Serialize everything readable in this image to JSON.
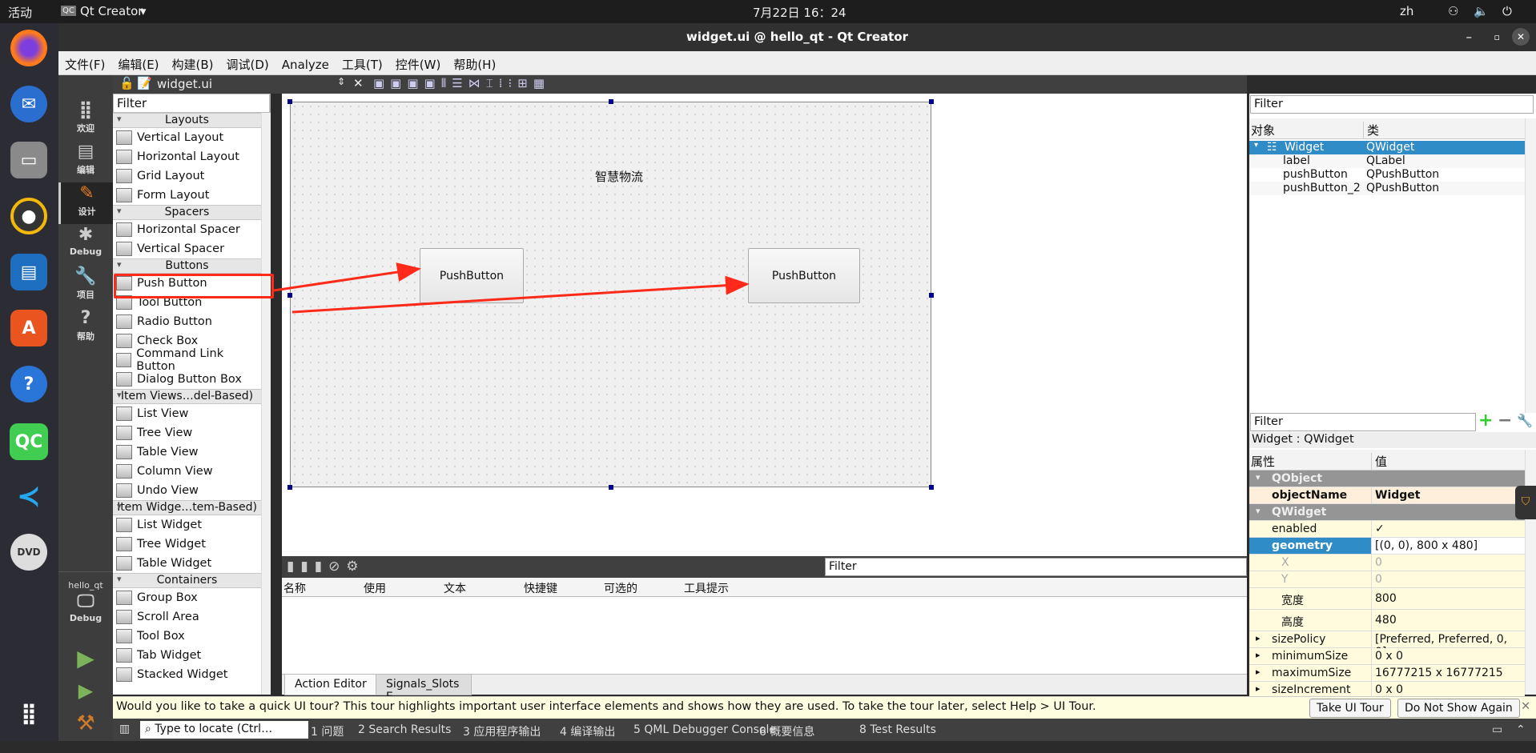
{
  "topbar": {
    "activities": "活动",
    "app": "Qt Creator",
    "clock": "7月22日  16：24",
    "lang": "zh"
  },
  "window": {
    "title": "widget.ui @ hello_qt - Qt Creator"
  },
  "menu": [
    "文件(F)",
    "编辑(E)",
    "构建(B)",
    "调试(D)",
    "Analyze",
    "工具(T)",
    "控件(W)",
    "帮助(H)"
  ],
  "modes": [
    {
      "label": "欢迎",
      "icon": "grid-icon"
    },
    {
      "label": "编辑",
      "icon": "document-icon"
    },
    {
      "label": "设计",
      "icon": "pencil-icon"
    },
    {
      "label": "Debug",
      "icon": "bug-icon"
    },
    {
      "label": "项目",
      "icon": "wrench-icon"
    },
    {
      "label": "帮助",
      "icon": "help-icon"
    }
  ],
  "kit": {
    "project": "hello_qt",
    "config": "Debug"
  },
  "editor": {
    "file": "widget.ui"
  },
  "widgetbox": {
    "filter": "Filter",
    "groups": [
      {
        "name": "Layouts",
        "items": [
          "Vertical Layout",
          "Horizontal Layout",
          "Grid Layout",
          "Form Layout"
        ]
      },
      {
        "name": "Spacers",
        "items": [
          "Horizontal Spacer",
          "Vertical Spacer"
        ]
      },
      {
        "name": "Buttons",
        "items": [
          "Push Button",
          "Tool Button",
          "Radio Button",
          "Check Box",
          "Command Link Button",
          "Dialog Button Box"
        ]
      },
      {
        "name": "Item Views…del-Based)",
        "items": [
          "List View",
          "Tree View",
          "Table View",
          "Column View",
          "Undo View"
        ]
      },
      {
        "name": "Item Widge…tem-Based)",
        "items": [
          "List Widget",
          "Tree Widget",
          "Table Widget"
        ]
      },
      {
        "name": "Containers",
        "items": [
          "Group Box",
          "Scroll Area",
          "Tool Box",
          "Tab Widget",
          "Stacked Widget"
        ]
      }
    ]
  },
  "form": {
    "label": "智慧物流",
    "button1": "PushButton",
    "button2": "PushButton"
  },
  "annotation": {
    "color": "#ff2a1a"
  },
  "action_editor": {
    "filter": "Filter",
    "columns": [
      "名称",
      "使用",
      "文本",
      "快捷键",
      "可选的",
      "工具提示"
    ],
    "tabs": [
      "Action Editor",
      "Signals_Slots E..."
    ]
  },
  "object_inspector": {
    "filter": "Filter",
    "columns": [
      "对象",
      "类"
    ],
    "rows": [
      [
        "Widget",
        "QWidget"
      ],
      [
        "label",
        "QLabel"
      ],
      [
        "pushButton",
        "QPushButton"
      ],
      [
        "pushButton_2",
        "QPushButton"
      ]
    ]
  },
  "property_editor": {
    "filter": "Filter",
    "title": "Widget : QWidget",
    "columns": [
      "属性",
      "值"
    ],
    "rows": [
      {
        "name": "QObject",
        "group": true
      },
      {
        "name": "objectName",
        "value": "Widget"
      },
      {
        "name": "QWidget",
        "group": true
      },
      {
        "name": "enabled",
        "value": "✓"
      },
      {
        "name": "geometry",
        "value": "[(0, 0), 800 x 480]"
      },
      {
        "name": "X",
        "value": "0"
      },
      {
        "name": "Y",
        "value": "0"
      },
      {
        "name": "宽度",
        "value": "800"
      },
      {
        "name": "高度",
        "value": "480"
      },
      {
        "name": "sizePolicy",
        "value": "[Preferred, Preferred, 0, 0]"
      },
      {
        "name": "minimumSize",
        "value": "0 x 0"
      },
      {
        "name": "maximumSize",
        "value": "16777215 x 16777215"
      },
      {
        "name": "sizeIncrement",
        "value": "0 x 0"
      }
    ]
  },
  "tour": {
    "message": "Would you like to take a quick UI tour? This tour highlights important user interface elements and shows how they are used. To take the tour later, select Help > UI Tour.",
    "take": "Take UI Tour",
    "dismiss": "Do Not Show Again"
  },
  "statusbar": {
    "locate": "Type to locate (Ctrl…",
    "panes": [
      "1 问题",
      "2 Search Results",
      "3 应用程序输出",
      "4 编译输出",
      "5 QML Debugger Console",
      "6 概要信息",
      "8 Test Results"
    ]
  }
}
